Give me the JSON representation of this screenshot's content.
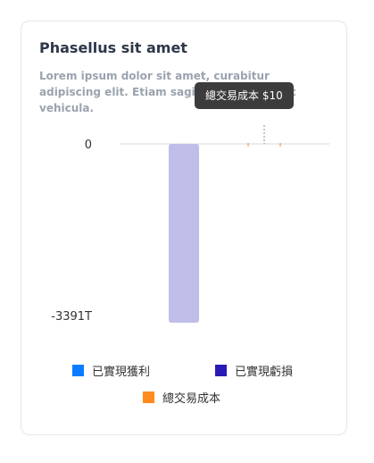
{
  "card": {
    "title": "Phasellus sit amet",
    "subtitle": "Lorem ipsum dolor sit amet, curabitur adipiscing elit. Etiam sagittis porttitor nec vehicula."
  },
  "tooltip": {
    "text": "總交易成本 $10"
  },
  "chart_data": {
    "type": "bar",
    "categories": [
      "",
      ""
    ],
    "series": [
      {
        "name": "已實現獲利",
        "color": "#0a7cff",
        "values": [
          0,
          0
        ]
      },
      {
        "name": "已實現虧損",
        "color": "#2a1ab8",
        "values": [
          -3391,
          0
        ]
      },
      {
        "name": "總交易成本",
        "color": "#ff8a1f",
        "values": [
          0,
          10
        ]
      }
    ],
    "bar_display_color": "#c1bde9",
    "y_ticks": [
      "0",
      "-3391T"
    ],
    "ylim": [
      -3391,
      0
    ],
    "legend_position": "bottom",
    "grid": false
  }
}
